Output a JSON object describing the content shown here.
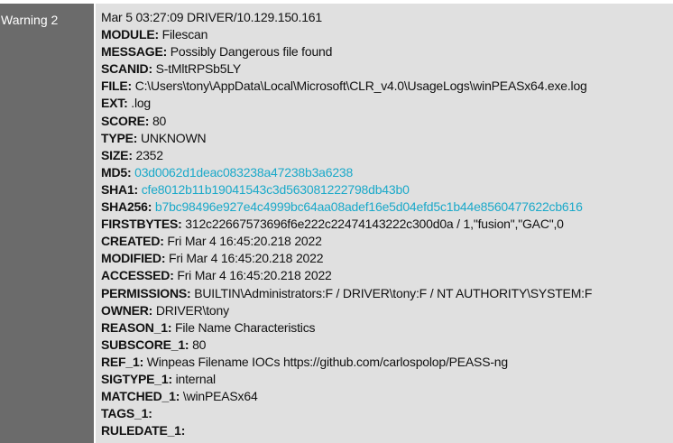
{
  "label": "Warning 2",
  "header_line": "Mar 5 03:27:09 DRIVER/10.129.150.161",
  "colors": {
    "label_bg": "#6b6b6b",
    "content_bg": "#e0e0e0",
    "hash_link": "#1ba9c9"
  },
  "fields": [
    {
      "key": "MODULE:",
      "value": "Filescan",
      "link": false
    },
    {
      "key": "MESSAGE:",
      "value": "Possibly Dangerous file found",
      "link": false
    },
    {
      "key": "SCANID:",
      "value": "S-tMltRPSb5LY",
      "link": false
    },
    {
      "key": "FILE:",
      "value": "C:\\Users\\tony\\AppData\\Local\\Microsoft\\CLR_v4.0\\UsageLogs\\winPEASx64.exe.log",
      "link": false
    },
    {
      "key": "EXT:",
      "value": ".log",
      "link": false
    },
    {
      "key": "SCORE:",
      "value": "80",
      "link": false
    },
    {
      "key": "TYPE:",
      "value": "UNKNOWN",
      "link": false
    },
    {
      "key": "SIZE:",
      "value": "2352",
      "link": false
    },
    {
      "key": "MD5:",
      "value": "03d0062d1deac083238a47238b3a6238",
      "link": true
    },
    {
      "key": "SHA1:",
      "value": "cfe8012b11b19041543c3d563081222798db43b0",
      "link": true
    },
    {
      "key": "SHA256:",
      "value": "b7bc98496e927e4c4999bc64aa08adef16e5d04efd5c1b44e8560477622cb616",
      "link": true
    },
    {
      "key": "FIRSTBYTES:",
      "value": "312c22667573696f6e222c22474143222c300d0a / 1,\"fusion\",\"GAC\",0",
      "link": false
    },
    {
      "key": "CREATED:",
      "value": "Fri Mar 4 16:45:20.218 2022",
      "link": false
    },
    {
      "key": "MODIFIED:",
      "value": "Fri Mar 4 16:45:20.218 2022",
      "link": false
    },
    {
      "key": "ACCESSED:",
      "value": "Fri Mar 4 16:45:20.218 2022",
      "link": false
    },
    {
      "key": "PERMISSIONS:",
      "value": "BUILTIN\\Administrators:F / DRIVER\\tony:F / NT AUTHORITY\\SYSTEM:F",
      "link": false
    },
    {
      "key": "OWNER:",
      "value": "DRIVER\\tony",
      "link": false
    },
    {
      "key": "REASON_1:",
      "value": "File Name Characteristics",
      "link": false
    },
    {
      "key": "SUBSCORE_1:",
      "value": "80",
      "link": false
    },
    {
      "key": "REF_1:",
      "value": "Winpeas Filename IOCs https://github.com/carlospolop/PEASS-ng",
      "link": false
    },
    {
      "key": "SIGTYPE_1:",
      "value": "internal",
      "link": false
    },
    {
      "key": "MATCHED_1:",
      "value": "\\winPEASx64",
      "link": false
    },
    {
      "key": "TAGS_1:",
      "value": "",
      "link": false
    },
    {
      "key": "RULEDATE_1:",
      "value": "",
      "link": false
    }
  ]
}
